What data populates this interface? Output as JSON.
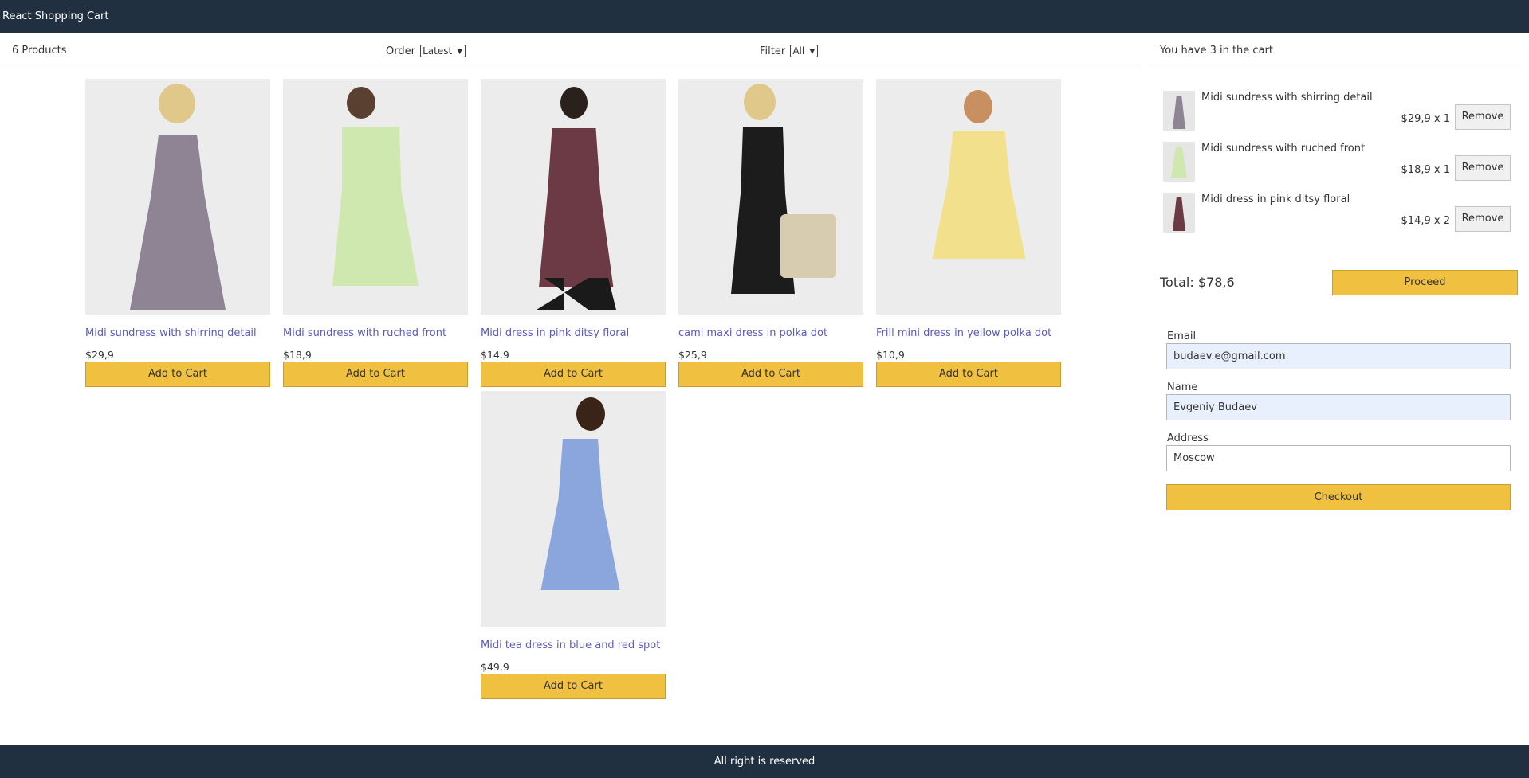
{
  "header": {
    "title": "React Shopping Cart"
  },
  "filter_bar": {
    "count_label": "6 Products",
    "order_label": "Order",
    "order_value": "Latest",
    "filter_label": "Filter",
    "filter_value": "All"
  },
  "products": [
    {
      "title": "Midi sundress with shirring detail",
      "price": "$29,9",
      "button": "Add to Cart",
      "color": "#8f8494"
    },
    {
      "title": "Midi sundress with ruched front",
      "price": "$18,9",
      "button": "Add to Cart",
      "color": "#cfe8b0"
    },
    {
      "title": "Midi dress in pink ditsy floral",
      "price": "$14,9",
      "button": "Add to Cart",
      "color": "#6b3a45"
    },
    {
      "title": "cami maxi dress in polka dot",
      "price": "$25,9",
      "button": "Add to Cart",
      "color": "#1c1c1c"
    },
    {
      "title": "Frill mini dress in yellow polka dot",
      "price": "$10,9",
      "button": "Add to Cart",
      "color": "#f2e08c"
    },
    {
      "title": "Midi tea dress in blue and red spot",
      "price": "$49,9",
      "button": "Add to Cart",
      "color": "#8aa6dc"
    }
  ],
  "cart": {
    "header": "You have 3 in the cart",
    "items": [
      {
        "name": "Midi sundress with shirring detail",
        "qty": "$29,9 x 1",
        "remove": "Remove"
      },
      {
        "name": "Midi sundress with ruched front",
        "qty": "$18,9 x 1",
        "remove": "Remove"
      },
      {
        "name": "Midi dress in pink ditsy floral",
        "qty": "$14,9 x 2",
        "remove": "Remove"
      }
    ],
    "total": "Total: $78,6",
    "proceed": "Proceed"
  },
  "checkout_form": {
    "email_label": "Email",
    "email_value": "budaev.e@gmail.com",
    "name_label": "Name",
    "name_value": "Evgeniy Budaev",
    "address_label": "Address",
    "address_value": "Moscow",
    "checkout_button": "Checkout"
  },
  "footer": {
    "text": "All right is reserved"
  },
  "colors": {
    "nav": "#203040",
    "accent": "#f0c040",
    "link": "#5b5bbd"
  }
}
